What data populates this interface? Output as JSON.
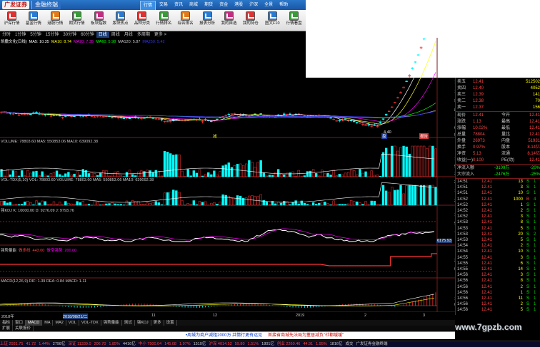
{
  "app": {
    "logo": "广发证券",
    "subtitle": "金融终端"
  },
  "menus": [
    "行情",
    "交易",
    "资讯",
    "商城",
    "期货",
    "资金",
    "港股",
    "沪深",
    "全景",
    "帮助"
  ],
  "toolbar": [
    {
      "label": "沪深行情",
      "color": "#d33"
    },
    {
      "label": "基金行情",
      "color": "#2a7ad0"
    },
    {
      "label": "港股行情",
      "color": "#e07a1a"
    },
    {
      "label": "期货行情",
      "color": "#3a9a3a"
    },
    {
      "label": "板块指数",
      "color": "#c03080"
    },
    {
      "label": "版块热点",
      "color": "#2a7ad0"
    },
    {
      "label": "品种分类",
      "color": "#d33"
    },
    {
      "label": "行情排名",
      "color": "#3a9a3a"
    },
    {
      "label": "综合排名",
      "color": "#e07a1a"
    },
    {
      "label": "报表分析",
      "color": "#2a7ad0"
    },
    {
      "label": "我的自选",
      "color": "#c03080"
    },
    {
      "label": "我的持仓",
      "color": "#d33"
    },
    {
      "label": "图文F10",
      "color": "#2a7ad0"
    },
    {
      "label": "行情看盘",
      "color": "#3a9a3a"
    }
  ],
  "periods": [
    "分时",
    "1分钟",
    "5分钟",
    "15分钟",
    "30分钟",
    "60分钟",
    "日线",
    "周线",
    "月线",
    "多周期",
    "更多 >"
  ],
  "panels": {
    "main": {
      "title": "凯撒文化(日线)",
      "ma": [
        {
          "t": "MA5: 10.35",
          "c": "#fff"
        },
        {
          "t": "MA10: 8.74",
          "c": "#ff0"
        },
        {
          "t": "MA20: 7.35",
          "c": "#f0f"
        },
        {
          "t": "MA60: 5.98",
          "c": "#0f0"
        },
        {
          "t": "MA120: 5.87",
          "c": "#ccc"
        },
        {
          "t": "MA250: 5.42",
          "c": "#33f"
        }
      ],
      "ticks": [
        "11.00",
        "10.00",
        "9.00",
        "8.00",
        "7.00",
        "6.00",
        "5.00"
      ],
      "low": "4.40",
      "mark1": "减",
      "mark2": "盘",
      "mark3": "报告"
    },
    "vol": {
      "title": "VOLUME: 78803.60 MA5: 550853.06 MA10: 639092.38",
      "ticks": [
        "1000",
        "500",
        "X100"
      ]
    },
    "vol2": {
      "title": "VOL-TDX(5,10) VOL: 78803.60 VOLUME: 78803.60 MA5: 550853.06 MA10: 639092.38",
      "ticks": [
        "2000",
        "1000",
        "X100"
      ]
    },
    "kdj": {
      "title": "强KDJ K: 10000.00 D: 9276.09 J: 9793.76",
      "ticks": [
        "10000",
        "9000",
        "7500"
      ],
      "badge": "6175.93"
    },
    "trend": {
      "title": "强势量能",
      "t1": "做多线",
      "t2": "443.00",
      "t3": "做空强势: 200.00",
      "ticks": [
        "250",
        "0"
      ]
    },
    "macd": {
      "title": "MACD(12,26,9) DIF: 1.39 DEA: 0.84 MACD: 1.11",
      "ticks": [
        "1",
        "0"
      ]
    },
    "dates": [
      "2018年",
      "2018/08/21/二",
      "11",
      "12",
      "2019",
      "2",
      "3"
    ]
  },
  "quote": {
    "asks": [
      {
        "l": "卖五",
        "p": "12.41",
        "v": "512502"
      },
      {
        "l": "卖四",
        "p": "12.40",
        "v": "4052"
      },
      {
        "l": "卖三",
        "p": "12.39",
        "v": "141"
      },
      {
        "l": "卖二",
        "p": "12.38",
        "v": "70"
      },
      {
        "l": "卖一",
        "p": "12.37",
        "v": "156"
      }
    ],
    "info": [
      {
        "l": "现价",
        "p": "12.41",
        "l2": "今开",
        "v": "12.41"
      },
      {
        "l": "涨跌",
        "p": "1.13",
        "l2": "最高",
        "v": "12.41"
      },
      {
        "l": "涨幅",
        "p": "10.02%",
        "l2": "最低",
        "v": "12.41"
      },
      {
        "l": "总量",
        "p": "78804",
        "l2": "量比",
        "v": "12.41"
      },
      {
        "l": "外盘",
        "p": "26973",
        "l2": "内盘",
        "v": "51931"
      },
      {
        "l": "换手",
        "p": "0.97%",
        "l2": "股本",
        "v": "8.14亿"
      },
      {
        "l": "净资",
        "p": "5.13",
        "l2": "流通",
        "v": "8.14亿"
      },
      {
        "l": "收益(一)",
        "p": "0.100",
        "l2": "PE(动)",
        "v": "12.41"
      }
    ],
    "flow": [
      {
        "l": "净流入额",
        "v": "-3109万",
        "p": "-20%"
      },
      {
        "l": "大宗流入",
        "v": "-2476万",
        "p": "-25%"
      }
    ],
    "ticks": [
      {
        "t": "14:51",
        "p": "12.41",
        "v": "13",
        "d": "S",
        "x": "1"
      },
      {
        "t": "14:51",
        "p": "12.41",
        "v": "3",
        "d": "S",
        "x": "1"
      },
      {
        "t": "14:51",
        "p": "12.41",
        "v": "10",
        "d": "S",
        "x": "1"
      },
      {
        "t": "14:52",
        "p": "12.41",
        "v": "1000",
        "d": "B",
        "x": "4"
      },
      {
        "t": "14:52",
        "p": "12.41",
        "v": "1",
        "d": "S",
        "x": "1"
      },
      {
        "t": "14:52",
        "p": "12.41",
        "v": "2",
        "d": "S",
        "x": "1"
      },
      {
        "t": "14:52",
        "p": "12.41",
        "v": "3",
        "d": "S",
        "x": "1"
      },
      {
        "t": "14:53",
        "p": "12.41",
        "v": "8",
        "d": "S",
        "x": "1"
      },
      {
        "t": "14:53",
        "p": "12.41",
        "v": "5",
        "d": "S",
        "x": "1"
      },
      {
        "t": "14:53",
        "p": "12.41",
        "v": "20",
        "d": "S",
        "x": "2"
      },
      {
        "t": "14:53",
        "p": "12.41",
        "v": "5",
        "d": "S",
        "x": "1"
      },
      {
        "t": "14:54",
        "p": "12.41",
        "v": "2",
        "d": "S",
        "x": "1"
      },
      {
        "t": "14:54",
        "p": "12.41",
        "v": "10",
        "d": "S",
        "x": "1"
      },
      {
        "t": "14:55",
        "p": "12.41",
        "v": "3",
        "d": "S",
        "x": "1"
      },
      {
        "t": "14:55",
        "p": "12.41",
        "v": "6",
        "d": "S",
        "x": "1"
      },
      {
        "t": "14:55",
        "p": "12.41",
        "v": "14",
        "d": "S",
        "x": "1"
      },
      {
        "t": "14:56",
        "p": "12.41",
        "v": "3",
        "d": "S",
        "x": "1"
      },
      {
        "t": "14:56",
        "p": "12.41",
        "v": "8",
        "d": "S",
        "x": "1"
      },
      {
        "t": "14:56",
        "p": "12.41",
        "v": "2",
        "d": "S",
        "x": "1"
      },
      {
        "t": "14:56",
        "p": "12.41",
        "v": "1",
        "d": "S",
        "x": "1"
      },
      {
        "t": "14:56",
        "p": "12.41",
        "v": "11",
        "d": "S",
        "x": "1"
      },
      {
        "t": "14:56",
        "p": "12.41",
        "v": "2",
        "d": "S",
        "x": "1"
      },
      {
        "t": "14:56",
        "p": "12.41",
        "v": "5",
        "d": "S",
        "x": "1"
      },
      {
        "t": "14:56",
        "p": "12.41",
        "v": "3",
        "d": "S",
        "x": "1"
      },
      {
        "t": "14:56",
        "p": "12.41",
        "v": "7",
        "d": "S",
        "x": "1"
      },
      {
        "t": "14:56",
        "p": "12.41",
        "v": "1",
        "d": "S",
        "x": "1"
      },
      {
        "t": "14:56",
        "p": "12.41",
        "v": "9",
        "d": "S",
        "x": "1"
      }
    ]
  },
  "tabs": [
    "指标",
    "窗口",
    "MACD",
    "MA",
    "MA2",
    "VOL",
    "VOL-TDX",
    "强势量能",
    "测试",
    "强KDJ",
    "更多",
    "设置"
  ],
  "subtabs": [
    "扩展",
    "关联报价"
  ],
  "marquee": {
    "m1": "•周城为商户减租2000万 共情行更有远见",
    "m2": "首接省商城先法局为董居减负\"社都缓缓\""
  },
  "watermark": "www.7gpzb.com",
  "status": [
    {
      "t": "上证 2931.75",
      "c": "#f44"
    },
    {
      "t": "41.72",
      "c": "#f44"
    },
    {
      "t": "1.44%",
      "c": "#f44"
    },
    {
      "t": "2798亿",
      "c": "#ccc"
    },
    {
      "t": "深证 11339.0",
      "c": "#f44"
    },
    {
      "t": "206.70",
      "c": "#f44"
    },
    {
      "t": "1.85%",
      "c": "#f44"
    },
    {
      "t": "4416亿",
      "c": "#ccc"
    },
    {
      "t": "中小 7500.04",
      "c": "#f44"
    },
    {
      "t": "145.08",
      "c": "#f44"
    },
    {
      "t": "1.97%",
      "c": "#f44"
    },
    {
      "t": "1510亿",
      "c": "#ccc"
    },
    {
      "t": "沪深 4014.52",
      "c": "#f44"
    },
    {
      "t": "59.80",
      "c": "#f44"
    },
    {
      "t": "1.51%",
      "c": "#f44"
    },
    {
      "t": "1801亿",
      "c": "#ccc"
    },
    {
      "t": "创业 2260.46",
      "c": "#f44"
    },
    {
      "t": "44.91",
      "c": "#f44"
    },
    {
      "t": "1.95%",
      "c": "#f44"
    },
    {
      "t": "1816亿",
      "c": "#ccc"
    },
    {
      "t": "成交",
      "c": "#ccc"
    },
    {
      "t": "广发证券金融终端",
      "c": "#ccc"
    }
  ]
}
